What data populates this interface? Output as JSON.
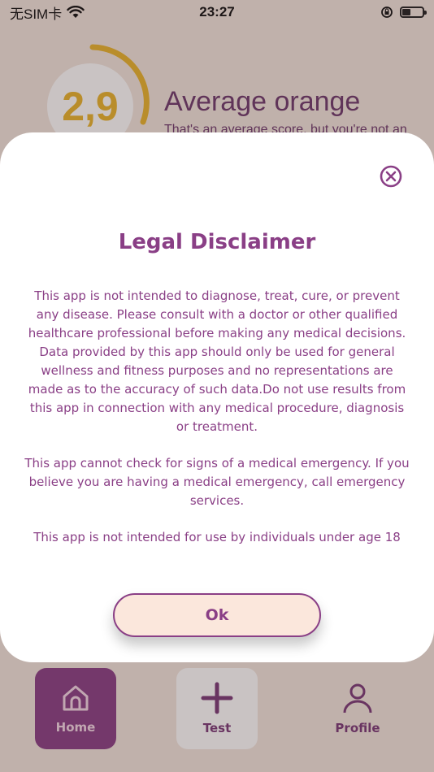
{
  "status_bar": {
    "carrier": "无SIM卡",
    "time": "23:27"
  },
  "background": {
    "score_value": "2,9",
    "score_title": "Average orange",
    "score_subtitle": "That's an average score, but you're not an"
  },
  "tab_bar": {
    "items": [
      {
        "label": "Home",
        "icon": "home-icon",
        "active": true
      },
      {
        "label": "Test",
        "icon": "plus-icon",
        "active": false
      },
      {
        "label": "Profile",
        "icon": "person-icon",
        "active": false
      }
    ]
  },
  "modal": {
    "title": "Legal Disclaimer",
    "paragraphs": [
      "This app is not intended to diagnose, treat, cure, or prevent any disease. Please consult with a doctor or other qualified healthcare professional before making any medical decisions. Data provided by this app should only be used for general wellness and fitness purposes and no representations are made as to the accuracy of such data.Do not use results from this app in connection with any medical procedure, diagnosis or treatment.",
      "This app cannot check for signs of a medical emergency. If you believe you are having a medical emergency, call emergency services.",
      "This app is not intended for use by individuals under age 18"
    ],
    "ok_label": "Ok"
  },
  "colors": {
    "accent": "#8a3f86",
    "score": "#e9b52d",
    "button_fill": "#fbe7dc"
  }
}
